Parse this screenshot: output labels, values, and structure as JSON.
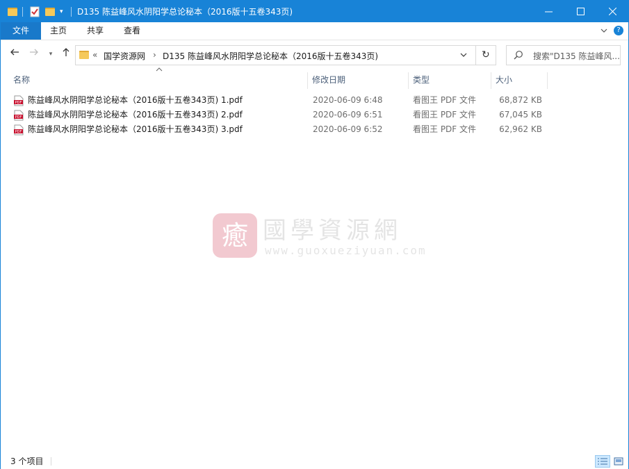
{
  "window": {
    "title": "D135 陈益峰风水阴阳学总论秘本（2016版十五卷343页)",
    "accent_color": "#1883d7"
  },
  "ribbon": {
    "tabs": [
      {
        "label": "文件"
      },
      {
        "label": "主页"
      },
      {
        "label": "共享"
      },
      {
        "label": "查看"
      }
    ]
  },
  "address": {
    "overflow": "«",
    "crumbs": [
      {
        "label": "国学资源网"
      },
      {
        "label": "D135 陈益峰风水阴阳学总论秘本（2016版十五卷343页)"
      }
    ],
    "search_placeholder": "搜索\"D135 陈益峰风..."
  },
  "columns": {
    "name": "名称",
    "modified": "修改日期",
    "type": "类型",
    "size": "大小"
  },
  "files": [
    {
      "name": "陈益峰风水阴阳学总论秘本（2016版十五卷343页) 1.pdf",
      "modified": "2020-06-09 6:48",
      "type": "看图王 PDF 文件",
      "size": "68,872 KB"
    },
    {
      "name": "陈益峰风水阴阳学总论秘本（2016版十五卷343页) 2.pdf",
      "modified": "2020-06-09 6:51",
      "type": "看图王 PDF 文件",
      "size": "67,045 KB"
    },
    {
      "name": "陈益峰风水阴阳学总论秘本（2016版十五卷343页) 3.pdf",
      "modified": "2020-06-09 6:52",
      "type": "看图王 PDF 文件",
      "size": "62,962 KB"
    }
  ],
  "status": {
    "item_count": "3 个项目"
  },
  "watermark": {
    "logo_char": "癒",
    "title": "國學資源網",
    "url": "www.guoxueziyuan.com"
  }
}
